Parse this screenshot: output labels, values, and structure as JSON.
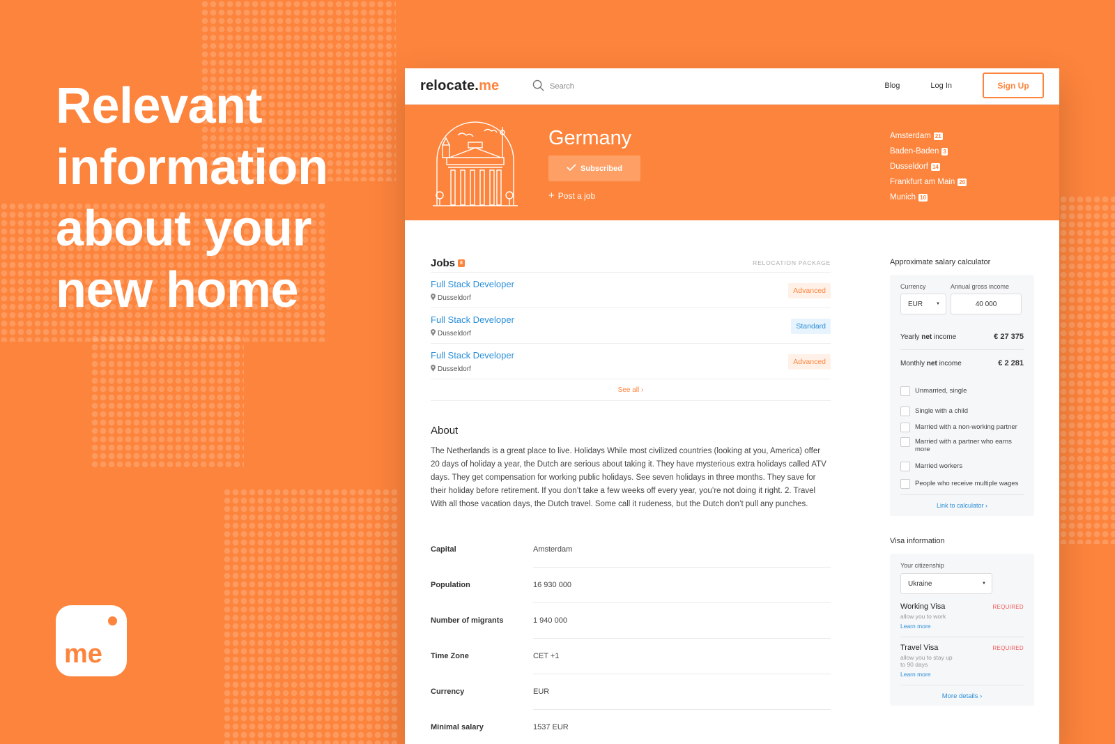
{
  "hero": {
    "lines": [
      "Relevant",
      "information",
      "about your",
      "new home"
    ]
  },
  "app_icon": {
    "text": "me"
  },
  "topbar": {
    "logo_main": "relocate.",
    "logo_accent": "me",
    "search_placeholder": "Search",
    "nav": {
      "blog": "Blog",
      "login": "Log In",
      "signup": "Sign Up"
    }
  },
  "banner": {
    "country": "Germany",
    "subscribed_label": "Subscribed",
    "post_job_label": "Post a job",
    "cities": [
      {
        "name": "Amsterdam",
        "count": "21"
      },
      {
        "name": "Baden-Baden",
        "count": "3"
      },
      {
        "name": "Dusseldorf",
        "count": "14"
      },
      {
        "name": "Frankfurt am Main",
        "count": "20"
      },
      {
        "name": "Munich",
        "count": "10"
      }
    ]
  },
  "jobs": {
    "title": "Jobs",
    "count": "8",
    "package_header": "RELOCATION PACKAGE",
    "items": [
      {
        "title": "Full Stack Developer",
        "location": "Dusseldorf",
        "package": "Advanced"
      },
      {
        "title": "Full Stack Developer",
        "location": "Dusseldorf",
        "package": "Standard"
      },
      {
        "title": "Full Stack Developer",
        "location": "Dusseldorf",
        "package": "Advanced"
      }
    ],
    "see_all": "See all ›"
  },
  "about": {
    "title": "About",
    "text": "The Netherlands is a great place to live. Holidays While most civilized countries (looking at you, America) offer 20 days of holiday a year, the Dutch are serious about taking it. They have mysterious extra holidays called ATV days. They get compensation for working public holidays. See seven holidays in three months. They save for their holiday before retirement. If you don’t take a few weeks off every year, you’re not doing it right. 2. Travel With all those vacation days, the Dutch travel. Some call it rudeness, but the Dutch don’t pull any punches."
  },
  "facts": [
    {
      "key": "Capital",
      "value": "Amsterdam"
    },
    {
      "key": "Population",
      "value": "16 930 000"
    },
    {
      "key": "Number of migrants",
      "value": "1 940 000"
    },
    {
      "key": "Time Zone",
      "value": "CET +1"
    },
    {
      "key": "Currency",
      "value": "EUR"
    },
    {
      "key": "Minimal salary",
      "value": "1537 EUR"
    }
  ],
  "calculator": {
    "title": "Approximate salary calculator",
    "currency_label": "Currency",
    "currency_value": "EUR",
    "gross_label": "Annual gross income",
    "gross_value": "40 000",
    "yearly_label_pre": "Yearly ",
    "yearly_label_bold": "net",
    "yearly_label_post": " income",
    "yearly_value": "€ 27 375",
    "monthly_label_pre": "Monthly ",
    "monthly_label_bold": "net",
    "monthly_label_post": " income",
    "monthly_value": "€ 2 281",
    "options": [
      "Unmarried, single",
      "Single with a child",
      "Married with a non-working partner",
      "Married with a partner who earns more",
      "Married workers",
      "People who receive multiple wages"
    ],
    "link": "Link to calculator ›"
  },
  "visa": {
    "title": "Visa information",
    "citizenship_label": "Your citizenship",
    "citizenship_value": "Ukraine",
    "items": [
      {
        "title": "Working Visa",
        "badge": "REQUIRED",
        "desc": "allow you to work",
        "link": "Learn more"
      },
      {
        "title": "Travel Visa",
        "badge": "REQUIRED",
        "desc": "allow you to stay up to 90 days",
        "link": "Learn more"
      }
    ],
    "more": "More details ›"
  },
  "colors": {
    "brand": "#fd843c",
    "link": "#2b8fd8",
    "required": "#f05a5a"
  }
}
